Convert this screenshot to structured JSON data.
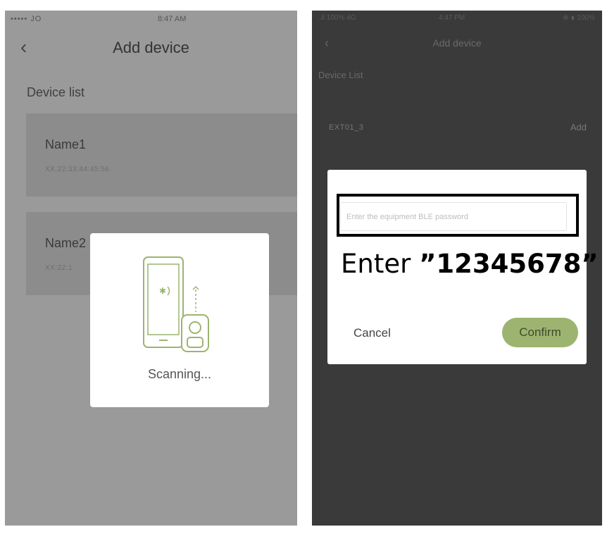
{
  "left_screen": {
    "status_bar": {
      "signal": "••••• JO",
      "time": "8:47 AM"
    },
    "nav": {
      "back_icon": "chevron-left-icon",
      "title": "Add device"
    },
    "section_label": "Device list",
    "devices": [
      {
        "name": "Name1",
        "address": "XX:22:33:44:45:56"
      },
      {
        "name": "Name2",
        "address": "XX:22:1"
      }
    ],
    "scan_dialog": {
      "illustration": "phone-bluetooth-device-icon",
      "text": "Scanning..."
    }
  },
  "right_screen": {
    "status_bar": {
      "signal": "..il 100% 4G",
      "time": "4:47 PM",
      "battery": "⊕ ∎ 100%"
    },
    "nav": {
      "back_icon": "chevron-left-icon",
      "title": "Add device"
    },
    "section_label": "Device List",
    "device_row": {
      "name": "EXT01_3",
      "action": "Add"
    },
    "password_dialog": {
      "input_placeholder": "Enter the equipment BLE password",
      "note_prefix": "Enter ",
      "note_code": "”12345678”",
      "cancel_label": "Cancel",
      "confirm_label": "Confirm"
    }
  },
  "colors": {
    "confirm_button": "#9cb470",
    "left_overlay": "#9a9a9a",
    "right_overlay": "#3a3a3a",
    "illustration_stroke": "#9cb470"
  }
}
